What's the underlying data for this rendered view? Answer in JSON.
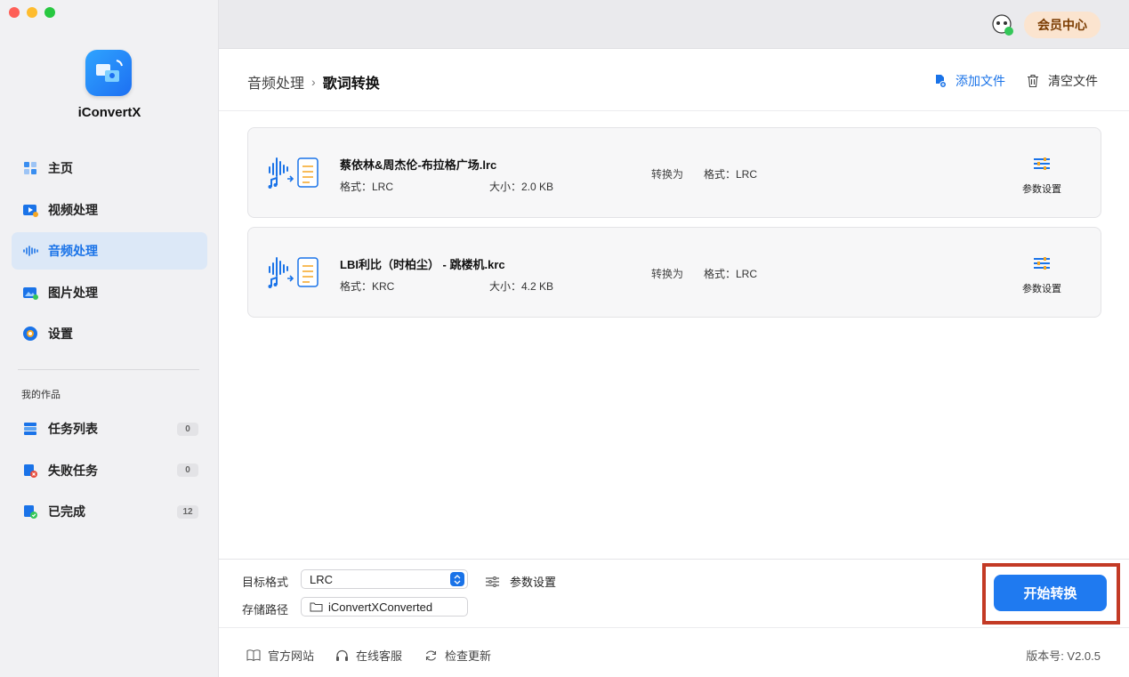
{
  "app": {
    "name": "iConvertX"
  },
  "sidebar": {
    "items": [
      {
        "label": "主页",
        "icon": "home-icon"
      },
      {
        "label": "视频处理",
        "icon": "video-icon"
      },
      {
        "label": "音频处理",
        "icon": "audio-icon",
        "active": true
      },
      {
        "label": "图片处理",
        "icon": "image-icon"
      },
      {
        "label": "设置",
        "icon": "settings-icon"
      }
    ],
    "section_title": "我的作品",
    "works": [
      {
        "label": "任务列表",
        "count": "0",
        "icon": "task-list-icon"
      },
      {
        "label": "失败任务",
        "count": "0",
        "icon": "failed-task-icon"
      },
      {
        "label": "已完成",
        "count": "12",
        "icon": "completed-icon"
      }
    ]
  },
  "topbar": {
    "member_label": "会员中心"
  },
  "header": {
    "breadcrumb_parent": "音频处理",
    "breadcrumb_separator": "›",
    "breadcrumb_current": "歌词转换",
    "add_file_label": "添加文件",
    "clear_file_label": "清空文件"
  },
  "files": [
    {
      "name": "蔡依林&周杰伦-布拉格广场.lrc",
      "format": "格式：LRC",
      "size": "大小：2.0 KB",
      "convert_to": "转换为",
      "target": "格式：LRC",
      "param_label": "参数设置"
    },
    {
      "name": "LBI利比（时柏尘） - 跳楼机.krc",
      "format": "格式：KRC",
      "size": "大小：4.2 KB",
      "convert_to": "转换为",
      "target": "格式：LRC",
      "param_label": "参数设置"
    }
  ],
  "bottom": {
    "target_format_label": "目标格式",
    "target_format_value": "LRC",
    "param_label": "参数设置",
    "save_path_label": "存储路径",
    "save_path_value": "iConvertXConverted",
    "start_label": "开始转换"
  },
  "footer": {
    "website": "官方网站",
    "support": "在线客服",
    "update": "检查更新",
    "version": "版本号:  V2.0.5"
  },
  "colors": {
    "accent": "#1f7af0",
    "highlight_frame": "#c33a25",
    "member_bg": "#fbe4cf"
  }
}
